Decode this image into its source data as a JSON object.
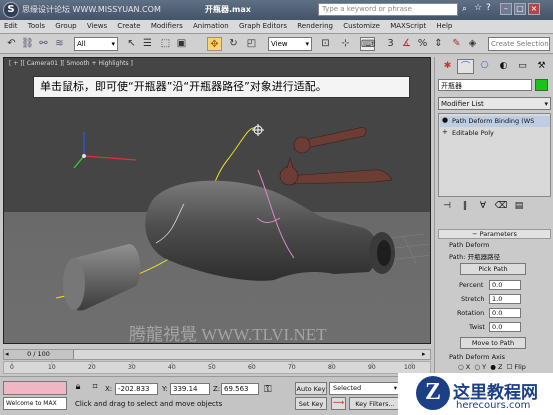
{
  "title_bar": {
    "title": "开瓶器.max",
    "search_placeholder": "Type a keyword or phrase",
    "brand_watermark": "思缘设计论坛 WWW.MISSYUAN.COM"
  },
  "menu": [
    "Edit",
    "Tools",
    "Group",
    "Views",
    "Create",
    "Modifiers",
    "Animation",
    "Graph Editors",
    "Rendering",
    "Customize",
    "MAXScript",
    "Help"
  ],
  "toolbar": {
    "selection_filter": "All",
    "reference_coord": "View",
    "named_selection_placeholder": "Create Selection Se",
    "snap_label": "3",
    "angle_snap_label": "2",
    "percent_snap_label": "%"
  },
  "viewport": {
    "label": "[ + ][ Camera01 ][ Smooth + Highlights ]",
    "callout": "单击鼠标，即可使“开瓶器”沿“开瓶器路径”对象进行适配。",
    "watermark": "腾龍視覺 WWW.TLVI.NET"
  },
  "command_panel": {
    "object_name": "开瓶器",
    "object_color": "#19c319",
    "modifier_list": "Modifier List",
    "stack": [
      {
        "label": "Path Deform Binding (WS",
        "selected": true
      },
      {
        "label": "Editable Poly",
        "selected": false
      }
    ],
    "params_header": "Parameters",
    "path_deform_label": "Path Deform",
    "path_label": "Path:",
    "path_value": "开瓶器路径",
    "pick_path": "Pick Path",
    "percent_label": "Percent",
    "percent_value": "0.0",
    "stretch_label": "Stretch",
    "stretch_value": "1.0",
    "rotation_label": "Rotation",
    "rotation_value": "0.0",
    "twist_label": "Twist",
    "twist_value": "0.0",
    "move_to_path": "Move to Path",
    "axis_label": "Path Deform Axis",
    "axis_x": "X",
    "axis_y": "Y",
    "axis_z": "Z",
    "flip": "Flip"
  },
  "timeline": {
    "slider_label": "0 / 100",
    "ticks": [
      "0",
      "10",
      "20",
      "30",
      "40",
      "50",
      "60",
      "70",
      "80",
      "90",
      "100"
    ]
  },
  "status": {
    "welcome": "Welcome to MAX",
    "x_label": "X:",
    "x_value": "-202.833",
    "y_label": "Y:",
    "y_value": "339.14",
    "z_label": "Z:",
    "z_value": "69.563",
    "prompt": "Click and drag to select and move objects",
    "auto_key": "Auto Key",
    "set_key": "Set Key",
    "selected": "Selected",
    "key_filters": "Key Filters..."
  },
  "logo": {
    "text": "这里教程网",
    "url": "herecours.com"
  }
}
